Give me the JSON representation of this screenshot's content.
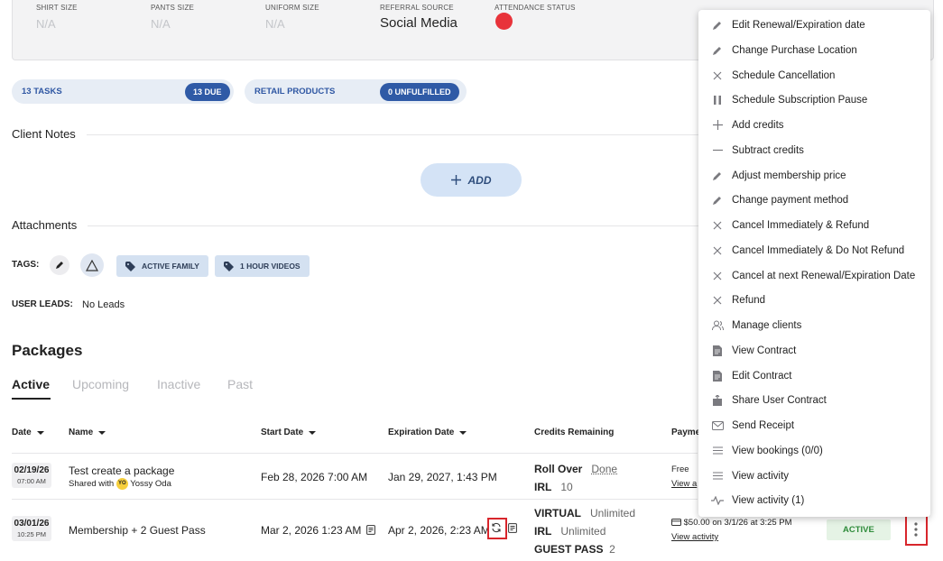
{
  "profile": {
    "fields": [
      {
        "label": "SHIRT SIZE",
        "value": "N/A"
      },
      {
        "label": "PANTS SIZE",
        "value": "N/A"
      },
      {
        "label": "UNIFORM SIZE",
        "value": "N/A"
      },
      {
        "label": "REFERRAL SOURCE",
        "value": "Social Media"
      },
      {
        "label": "ATTENDANCE STATUS"
      }
    ],
    "attendance_color": "#e8333a"
  },
  "summary": {
    "tasks": {
      "label": "13 TASKS",
      "badge": "13 DUE"
    },
    "retail": {
      "label": "RETAIL PRODUCTS",
      "badge": "0 UNFULFILLED"
    }
  },
  "client_notes": {
    "title": "Client Notes",
    "add_label": "ADD"
  },
  "attachments": {
    "title": "Attachments"
  },
  "tags": {
    "label": "TAGS:",
    "items": [
      "ACTIVE FAMILY",
      "1 HOUR VIDEOS"
    ]
  },
  "user_leads": {
    "label": "USER LEADS:",
    "value": "No Leads"
  },
  "packages": {
    "title": "Packages",
    "tabs": [
      "Active",
      "Upcoming",
      "Inactive",
      "Past"
    ],
    "columns": [
      "Date",
      "Name",
      "Start Date",
      "Expiration Date",
      "Credits Remaining",
      "Payme"
    ],
    "rows": [
      {
        "date": "02/19/26",
        "time": "07:00 AM",
        "name": "Test create a package",
        "shared_prefix": "Shared with",
        "shared_initials": "YO",
        "shared_name": "Yossy Oda",
        "start": "Feb 28, 2026 7:00 AM",
        "expiration": "Jan 29, 2027, 1:43 PM",
        "credits": [
          {
            "label": "Roll Over",
            "value": "Done"
          },
          {
            "label": "IRL",
            "value": "10"
          }
        ],
        "payment": "Free",
        "payment_link": "View a"
      },
      {
        "date": "03/01/26",
        "time": "10:25 PM",
        "name": "Membership + 2 Guest Pass",
        "start": "Mar 2, 2026 1:23 AM",
        "expiration": "Apr 2, 2026, 2:23 AM",
        "credits": [
          {
            "label": "VIRTUAL",
            "value": "Unlimited"
          },
          {
            "label": "IRL",
            "value": "Unlimited"
          },
          {
            "label": "GUEST PASS",
            "value": "2"
          }
        ],
        "payment": "$50.00 on 3/1/26 at 3:25 PM",
        "payment_link": "View activity",
        "status": "ACTIVE"
      }
    ]
  },
  "menu": {
    "items": [
      {
        "icon": "pencil-icon",
        "label": "Edit Renewal/Expiration date"
      },
      {
        "icon": "pencil-icon",
        "label": "Change Purchase Location"
      },
      {
        "icon": "x-icon",
        "label": "Schedule Cancellation"
      },
      {
        "icon": "pause-icon",
        "label": "Schedule Subscription Pause"
      },
      {
        "icon": "plus-icon",
        "label": "Add credits"
      },
      {
        "icon": "minus-icon",
        "label": "Subtract credits"
      },
      {
        "icon": "pencil-icon",
        "label": "Adjust membership price"
      },
      {
        "icon": "pencil-icon",
        "label": "Change payment method"
      },
      {
        "icon": "x-icon",
        "label": "Cancel Immediately & Refund"
      },
      {
        "icon": "x-icon",
        "label": "Cancel Immediately & Do Not Refund"
      },
      {
        "icon": "x-icon",
        "label": "Cancel at next Renewal/Expiration Date"
      },
      {
        "icon": "x-icon",
        "label": "Refund"
      },
      {
        "icon": "users-icon",
        "label": "Manage clients"
      },
      {
        "icon": "document-icon",
        "label": "View Contract"
      },
      {
        "icon": "document-icon",
        "label": "Edit Contract"
      },
      {
        "icon": "share-icon",
        "label": "Share User Contract"
      },
      {
        "icon": "envelope-icon",
        "label": "Send Receipt"
      },
      {
        "icon": "list-icon",
        "label": "View bookings (0/0)"
      },
      {
        "icon": "list-icon",
        "label": "View activity"
      },
      {
        "icon": "activity-icon",
        "label": "View activity (1)"
      }
    ]
  },
  "colors": {
    "accent": "#2f5aa6",
    "annotation": "#d8262c",
    "active_badge": "#2e8b3a"
  }
}
